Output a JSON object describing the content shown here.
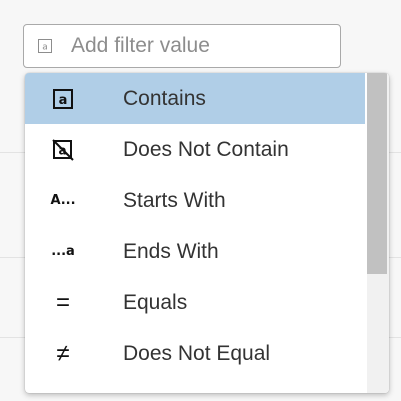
{
  "filter": {
    "placeholder": "Add filter value",
    "icon": "text-a-icon"
  },
  "menu": {
    "options": [
      {
        "label": "Contains",
        "icon": "contains-icon",
        "selected": true
      },
      {
        "label": "Does Not Contain",
        "icon": "does-not-contain-icon",
        "selected": false
      },
      {
        "label": "Starts With",
        "icon": "starts-with-icon",
        "glyph": "A..."
      },
      {
        "label": "Ends With",
        "icon": "ends-with-icon",
        "glyph": "...a"
      },
      {
        "label": "Equals",
        "icon": "equals-icon",
        "glyph": "="
      },
      {
        "label": "Does Not Equal",
        "icon": "not-equal-icon",
        "glyph": "≠"
      }
    ]
  },
  "colors": {
    "selected_bg": "#b0cee7",
    "scroll_thumb": "#c1c1c1"
  }
}
